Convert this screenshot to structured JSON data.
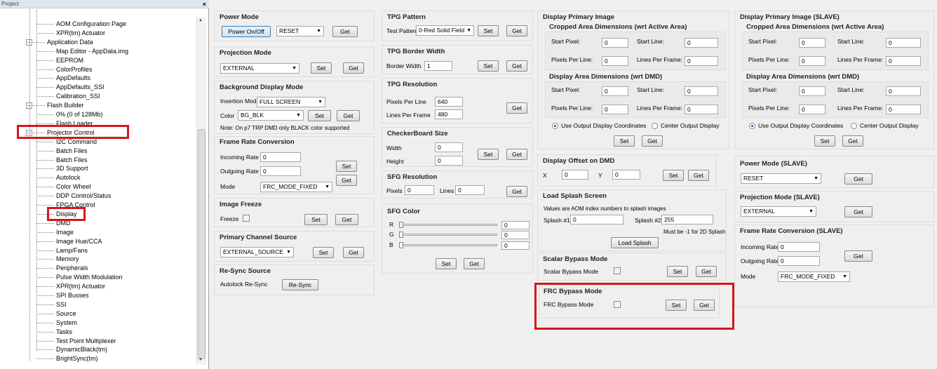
{
  "tree": {
    "title": "Project",
    "close": "×",
    "items": [
      "AOM Configuration Page",
      "XPR(tm) Actuator",
      "Application Data",
      "Map Editor - AppData.img",
      "EEPROM",
      "ColorProfiles",
      "AppDefaults",
      "AppDefaults_SSI",
      "Calibration_SSI",
      "Flash Builder",
      "0% (0 of 128Mb)",
      "Flash Loader",
      "Projector Control",
      "I2C Command",
      "Batch Files",
      "Batch Files",
      "3D Support",
      "Autolock",
      "Color Wheel",
      "DDP Control/Status",
      "FPGA Control",
      "Display",
      "DMD",
      "Image",
      "Image Hue/CCA",
      "Lamp/Fans",
      "Memory",
      "Peripherals",
      "Pulse Width Modulation",
      "XPR(tm) Actuator",
      "SPI Busses",
      "SSI",
      "Source",
      "System",
      "Tasks",
      "Test Point Multiplexer",
      "DynamicBlack(tm)",
      "BrightSync(tm)"
    ],
    "toggle_minus": "−"
  },
  "power_mode": {
    "title": "Power Mode",
    "btn_onoff": "Power On/Off",
    "combo": "RESET",
    "get": "Get"
  },
  "projection_mode": {
    "title": "Projection Mode",
    "combo": "EXTERNAL",
    "set": "Set",
    "get": "Get"
  },
  "background": {
    "title": "Background Display Mode",
    "insertion_label": "Insertion Mode",
    "insertion": "FULL SCREEN",
    "color_label": "Color",
    "color": "BG_BLK",
    "set": "Set",
    "get": "Get",
    "note": "Note: On p7 TRP DMD only BLACK color supported"
  },
  "frame_rate": {
    "title": "Frame Rate Conversion",
    "incoming_label": "Incoming Rate",
    "incoming": "0",
    "outgoing_label": "Outgoing Rate",
    "outgoing": "0",
    "mode_label": "Mode",
    "mode": "FRC_MODE_FIXED",
    "set": "Set",
    "get": "Get"
  },
  "image_freeze": {
    "title": "Image Freeze",
    "label": "Freeze",
    "set": "Set",
    "get": "Get"
  },
  "primary_source": {
    "title": "Primary Channel Source",
    "combo": "EXTERNAL_SOURCE",
    "set": "Set",
    "get": "Get"
  },
  "resync": {
    "title": "Re-Sync Source",
    "label": "Autolock Re-Sync",
    "btn": "Re-Sync"
  },
  "tpg_pattern": {
    "title": "TPG Pattern",
    "label": "Test Pattern",
    "combo": "0-Red Solid Field",
    "set": "Set",
    "get": "Get"
  },
  "tpg_border": {
    "title": "TPG Border Width",
    "label": "Border Width",
    "value": "1",
    "set": "Set",
    "get": "Get"
  },
  "tpg_resolution": {
    "title": "TPG Resolution",
    "ppl_label": "Pixels Per Line",
    "ppl": "640",
    "lpf_label": "Lines Per Frame",
    "lpf": "480",
    "get": "Get"
  },
  "checkerboard": {
    "title": "CheckerBoard Size",
    "width_label": "Width",
    "width": "0",
    "height_label": "Height",
    "height": "0",
    "set": "Set",
    "get": "Get"
  },
  "sfg_resolution": {
    "title": "SFG Resolution",
    "pixels_label": "Pixels",
    "pixels": "0",
    "lines_label": "Lines",
    "lines": "0",
    "get": "Get"
  },
  "sfg_color": {
    "title": "SFG Color",
    "r": "R",
    "g": "G",
    "b": "B",
    "rv": "0",
    "gv": "0",
    "bv": "0",
    "set": "Set",
    "get": "Get"
  },
  "display_primary": {
    "title": "Display Primary Image",
    "cropped_title": "Cropped Area Dimensions (wrt Active Area)",
    "display_title": "Display Area Dimensions (wrt DMD)",
    "start_pixel": "Start Pixel:",
    "start_line": "Start Line:",
    "ppl": "Pixels Per Line:",
    "lpf": "Lines Per Frame:",
    "c_sp": "0",
    "c_sl": "0",
    "c_ppl": "0",
    "c_lpf": "0",
    "d_sp": "0",
    "d_sl": "0",
    "d_ppl": "0",
    "d_lpf": "0",
    "radio_output": "Use Output Display Coordinates",
    "radio_center": "Center Output Display",
    "set": "Set",
    "get": "Get"
  },
  "display_slave": {
    "title": "Display Primary Image (SLAVE)",
    "cropped_title": "Cropped Area Dimensions (wrt Active Area)",
    "display_title": "Display Area Dimensions (wrt DMD)",
    "start_pixel": "Start Pixel:",
    "start_line": "Start Line:",
    "ppl": "Pixels Per Line:",
    "lpf": "Lines Per Frame:",
    "c_sp": "0",
    "c_sl": "0",
    "c_ppl": "0",
    "c_lpf": "0",
    "d_sp": "0",
    "d_sl": "0",
    "d_ppl": "0",
    "d_lpf": "0",
    "radio_output": "Use Output Display Coordinates",
    "radio_center": "Center Output Display",
    "set": "Set",
    "get": "Get"
  },
  "offset": {
    "title": "Display Offset on DMD",
    "x_label": "X",
    "x": "0",
    "y_label": "Y",
    "y": "0",
    "set": "Set",
    "get": "Get"
  },
  "splash": {
    "title": "Load Splash Screen",
    "note": "Values are AOM index numbers to splash images",
    "s1_label": "Splash #1",
    "s1": "0",
    "s2_label": "Splash #2",
    "s2": "255",
    "hint": "Must be -1 for 2D Splash",
    "btn": "Load Splash"
  },
  "scalar_bypass": {
    "title": "Scalar Bypass Mode",
    "label": "Scalar Bypass Mode",
    "set": "Set",
    "get": "Get"
  },
  "frc_bypass": {
    "title": "FRC Bypass Mode",
    "label": "FRC Bypass Mode",
    "set": "Set",
    "get": "Get"
  },
  "power_slave": {
    "title": "Power Mode (SLAVE)",
    "combo": "RESET",
    "get": "Get"
  },
  "projection_slave": {
    "title": "Projection Mode (SLAVE)",
    "combo": "EXTERNAL",
    "get": "Get"
  },
  "frc_slave": {
    "title": "Frame Rate Conversion (SLAVE)",
    "incoming_label": "Incoming Rate",
    "incoming": "0",
    "outgoing_label": "Outgoing Rate",
    "outgoing": "0",
    "mode_label": "Mode",
    "mode": "FRC_MODE_FIXED",
    "get": "Get"
  },
  "icons": {
    "dropdown": "▼",
    "scroll_up": "▲",
    "scroll_down": "▼"
  },
  "colors": {
    "highlight": "#d8151d"
  }
}
